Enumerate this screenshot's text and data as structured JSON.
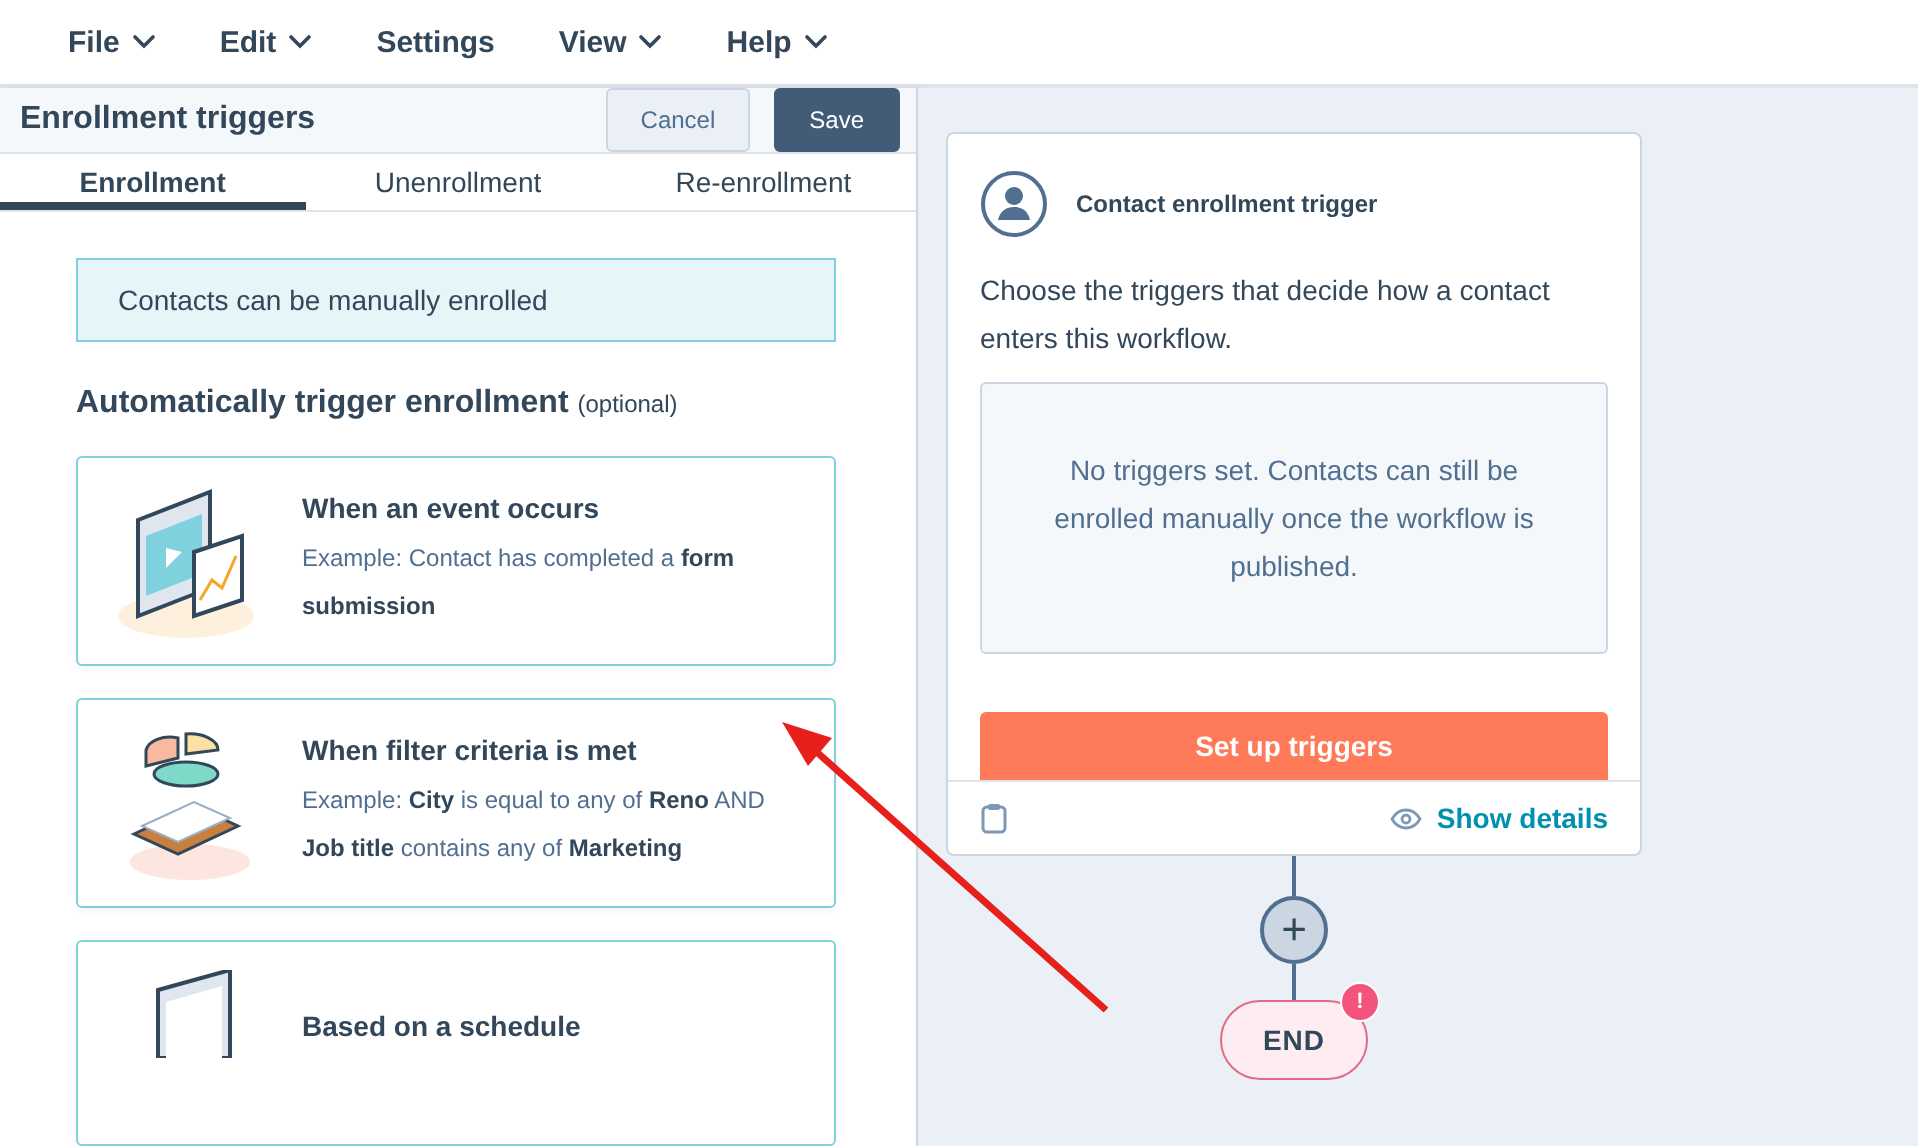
{
  "menu_bar": [
    {
      "label": "File",
      "has_dropdown": true
    },
    {
      "label": "Edit",
      "has_dropdown": true
    },
    {
      "label": "Settings",
      "has_dropdown": false
    },
    {
      "label": "View",
      "has_dropdown": true
    },
    {
      "label": "Help",
      "has_dropdown": true
    }
  ],
  "panel": {
    "title": "Enrollment triggers",
    "cancel_button": "Cancel",
    "save_button": "Save",
    "tabs": [
      {
        "label": "Enrollment",
        "selected": true
      },
      {
        "label": "Unenrollment",
        "selected": false
      },
      {
        "label": "Re-enrollment",
        "selected": false
      }
    ],
    "notice": "Contacts can be manually enrolled",
    "section_title": "Automatically trigger enrollment",
    "section_note": "(optional)",
    "options": [
      {
        "kind": "event",
        "title": "When an event occurs",
        "description": "Example: Contact has completed a **form submission**"
      },
      {
        "kind": "filter",
        "title": "When filter criteria is met",
        "description": "Example: **City** is equal to any of **Reno** AND **Job title** contains any of **Marketing**"
      },
      {
        "kind": "schedule",
        "title": "Based on a schedule"
      }
    ]
  },
  "canvas": {
    "trigger_card": {
      "title": "Contact enrollment trigger",
      "description": "Choose the triggers that decide how a contact enters this workflow.",
      "empty_message": "No triggers set. Contacts can still be enrolled manually once the workflow is published.",
      "button": "Set up triggers",
      "details_link": "Show details"
    },
    "add_button": "+",
    "end_node": {
      "label": "END",
      "alert": "!"
    }
  }
}
